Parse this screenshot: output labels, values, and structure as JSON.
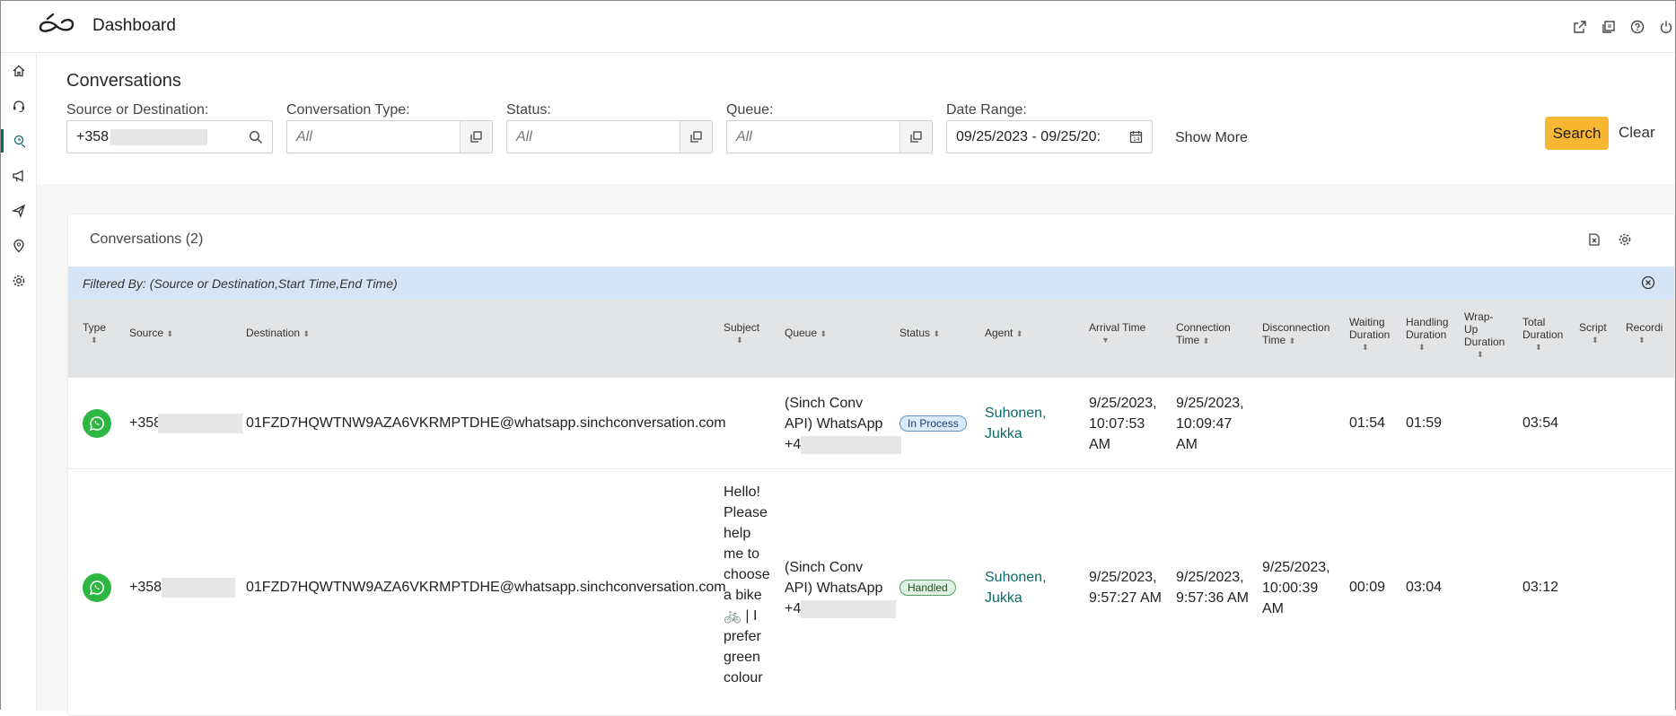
{
  "app": {
    "title": "Dashboard"
  },
  "top_icons": [
    "external-link-icon",
    "notes-icon",
    "help-icon",
    "power-icon"
  ],
  "sidebar": {
    "items": [
      {
        "icon": "home-icon"
      },
      {
        "icon": "headset-icon"
      },
      {
        "icon": "conversations-icon",
        "active": true
      },
      {
        "icon": "megaphone-icon"
      },
      {
        "icon": "send-icon"
      },
      {
        "icon": "location-icon"
      },
      {
        "icon": "settings-icon"
      }
    ]
  },
  "filters": {
    "page_title": "Conversations",
    "source": {
      "label": "Source or Destination:",
      "value": "+358"
    },
    "type": {
      "label": "Conversation Type:",
      "placeholder": "All"
    },
    "status": {
      "label": "Status:",
      "placeholder": "All"
    },
    "queue": {
      "label": "Queue:",
      "placeholder": "All"
    },
    "date": {
      "label": "Date Range:",
      "value": "09/25/2023 - 09/25/20:"
    },
    "show_more": "Show More",
    "search": "Search",
    "clear": "Clear"
  },
  "panel": {
    "title": "Conversations (2)",
    "filtered_by": "Filtered By: (Source or Destination,Start Time,End Time)"
  },
  "columns": {
    "type": "Type",
    "source": "Source",
    "destination": "Destination",
    "subject": "Subject",
    "queue": "Queue",
    "status": "Status",
    "agent": "Agent",
    "arrival_1": "Arrival Time",
    "connection_1": "Connection",
    "connection_2": "Time",
    "disconnection_1": "Disconnection",
    "disconnection_2": "Time",
    "waiting_1": "Waiting",
    "waiting_2": "Duration",
    "handling_1": "Handling",
    "handling_2": "Duration",
    "wrapup_1": "Wrap-",
    "wrapup_2": "Up",
    "wrapup_3": "Duration",
    "total_1": "Total",
    "total_2": "Duration",
    "script": "Script",
    "recording": "Recordi"
  },
  "rows": [
    {
      "source": "+358",
      "destination": "01FZD7HQWTNW9AZA6VKRMPTDHE@whatsapp.sinchconversation.com",
      "subject": [],
      "queue": [
        "(Sinch Conv",
        "API) WhatsApp",
        "+4"
      ],
      "status": "In Process",
      "agent": [
        "Suhonen,",
        "Jukka"
      ],
      "arrival": [
        "9/25/2023,",
        "10:07:53",
        "AM"
      ],
      "connection": [
        "9/25/2023,",
        "10:09:47",
        "AM"
      ],
      "disconnection": [],
      "waiting": "01:54",
      "handling": "01:59",
      "total": "03:54"
    },
    {
      "source": "+358",
      "destination": "01FZD7HQWTNW9AZA6VKRMPTDHE@whatsapp.sinchconversation.com",
      "subject": [
        "Hello!",
        "Please",
        "help",
        "me to",
        "choose",
        "a bike",
        "🚲 | I",
        "prefer",
        "green",
        "colour"
      ],
      "queue": [
        "(Sinch Conv",
        "API) WhatsApp",
        "+4"
      ],
      "status": "Handled",
      "agent": [
        "Suhonen,",
        "Jukka"
      ],
      "arrival": [
        "9/25/2023,",
        "9:57:27 AM"
      ],
      "connection": [
        "9/25/2023,",
        "9:57:36 AM"
      ],
      "disconnection": [
        "9/25/2023,",
        "10:00:39",
        "AM"
      ],
      "waiting": "00:09",
      "handling": "03:04",
      "total": "03:12"
    }
  ]
}
